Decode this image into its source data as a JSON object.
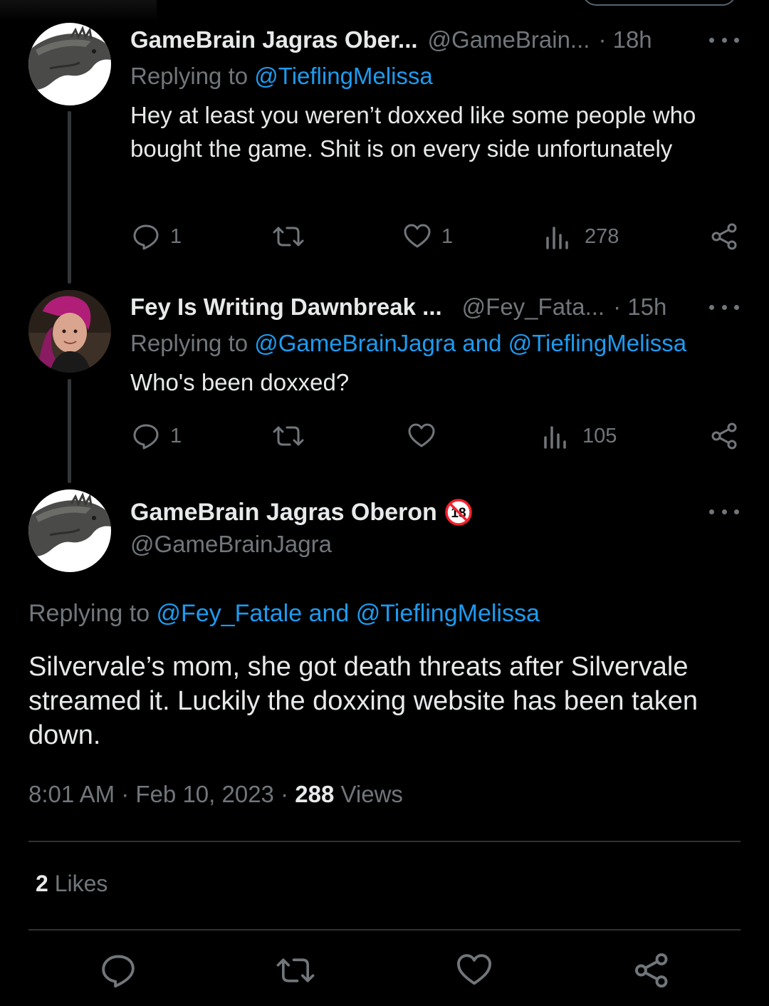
{
  "colors": {
    "background": "#000000",
    "text": "#e7e9ea",
    "muted": "#71767b",
    "link": "#1d9bf0",
    "divider": "#2f3336",
    "badge_red": "#f4212e"
  },
  "thread": [
    {
      "avatar": "dinosaur-head-avatar",
      "display_name": "GameBrain Jagras Ober...",
      "handle": "@GameBrain...",
      "time": "· 18h",
      "replying_prefix": "Replying to ",
      "replying_to": "@TieflingMelissa",
      "text": "Hey at least you weren’t doxxed like some people who bought the game. Shit is on every side unfortunately",
      "actions": {
        "replies": "1",
        "retweets": "",
        "likes": "1",
        "views": "278"
      }
    },
    {
      "avatar": "woman-photo-avatar",
      "display_name": "Fey Is Writing Dawnbreak ...",
      "handle": "@Fey_Fata...",
      "time": "· 15h",
      "replying_prefix": "Replying to ",
      "replying_to": "@GameBrainJagra and @TieflingMelissa",
      "text": "Who's been doxxed?",
      "actions": {
        "replies": "1",
        "retweets": "",
        "likes": "",
        "views": "105"
      }
    }
  ],
  "main_tweet": {
    "avatar": "dinosaur-head-avatar",
    "display_name": "GameBrain Jagras Oberon",
    "badge": "18",
    "handle": "@GameBrainJagra",
    "replying_prefix": "Replying to ",
    "replying_to": "@Fey_Fatale and @TieflingMelissa",
    "text": "Silvervale’s mom, she got death threats after Silvervale streamed it. Luckily the doxxing website has been taken down.",
    "time": "8:01 AM",
    "sep1": " · ",
    "date": "Feb 10, 2023",
    "sep2": " · ",
    "views_count": "288",
    "views_label": " Views",
    "likes_count": "2",
    "likes_label": " Likes"
  },
  "bottom_actions": [
    "reply-icon",
    "retweet-icon",
    "like-icon",
    "share-icon"
  ]
}
